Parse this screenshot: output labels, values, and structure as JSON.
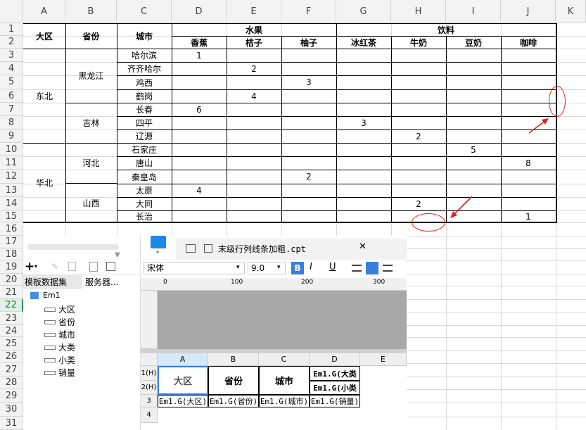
{
  "sheet": {
    "columns": [
      "A",
      "B",
      "C",
      "D",
      "E",
      "F",
      "G",
      "H",
      "I",
      "J",
      "K"
    ],
    "rows": [
      "1",
      "2",
      "3",
      "4",
      "5",
      "6",
      "7",
      "8",
      "9",
      "10",
      "11",
      "12",
      "13",
      "14",
      "15",
      "16",
      "17",
      "18",
      "19",
      "20",
      "21",
      "22",
      "23",
      "24",
      "25",
      "26",
      "27",
      "28",
      "29",
      "30",
      "31"
    ],
    "selected_row": "22",
    "headers": {
      "region": "大区",
      "province": "省份",
      "city": "城市",
      "fruit": "水果",
      "drink": "饮料"
    },
    "subheaders": [
      "香蕉",
      "桔子",
      "柚子",
      "冰红茶",
      "牛奶",
      "豆奶",
      "咖啡"
    ],
    "regions": [
      "东北",
      "华北"
    ],
    "provinces": [
      "黑龙江",
      "吉林",
      "河北",
      "山西"
    ],
    "cities": [
      "哈尔滨",
      "齐齐哈尔",
      "鸡西",
      "鹤岗",
      "长春",
      "四平",
      "辽源",
      "石家庄",
      "唐山",
      "秦皇岛",
      "太原",
      "大同",
      "长治"
    ],
    "values": {
      "r3_d": "1",
      "r4_e": "2",
      "r5_f": "3",
      "r6_e": "4",
      "r7_d": "6",
      "r8_g": "3",
      "r9_h": "2",
      "r10_i": "5",
      "r11_j": "8",
      "r12_f": "2",
      "r13_d": "4",
      "r14_h": "2",
      "r15_j": "1"
    }
  },
  "panel": {
    "tab_datasets": "模板数据集",
    "tab_server": "服务器...",
    "tree_root": "Em1",
    "fields": [
      "大区",
      "省份",
      "城市",
      "大类",
      "小类",
      "销量"
    ]
  },
  "editor": {
    "tab_title": "末级行列线条加粗.cpt",
    "font_name": "宋体",
    "font_size": "9.0",
    "ruler_marks": [
      "0",
      "100",
      "200",
      "300"
    ],
    "cols": [
      "A",
      "B",
      "C",
      "D",
      "E"
    ],
    "rows": [
      "1(H)",
      "2(H)",
      "3",
      "4"
    ],
    "h_region": "大区",
    "h_province": "省份",
    "h_city": "城市",
    "h_d1": "Em1.G(大类",
    "h_d2": "Em1.G(小类",
    "r3": [
      "Em1.G(大区)",
      "Em1.G(省份)",
      "Em1.G(城市)",
      "Em1.G(销量)"
    ]
  }
}
